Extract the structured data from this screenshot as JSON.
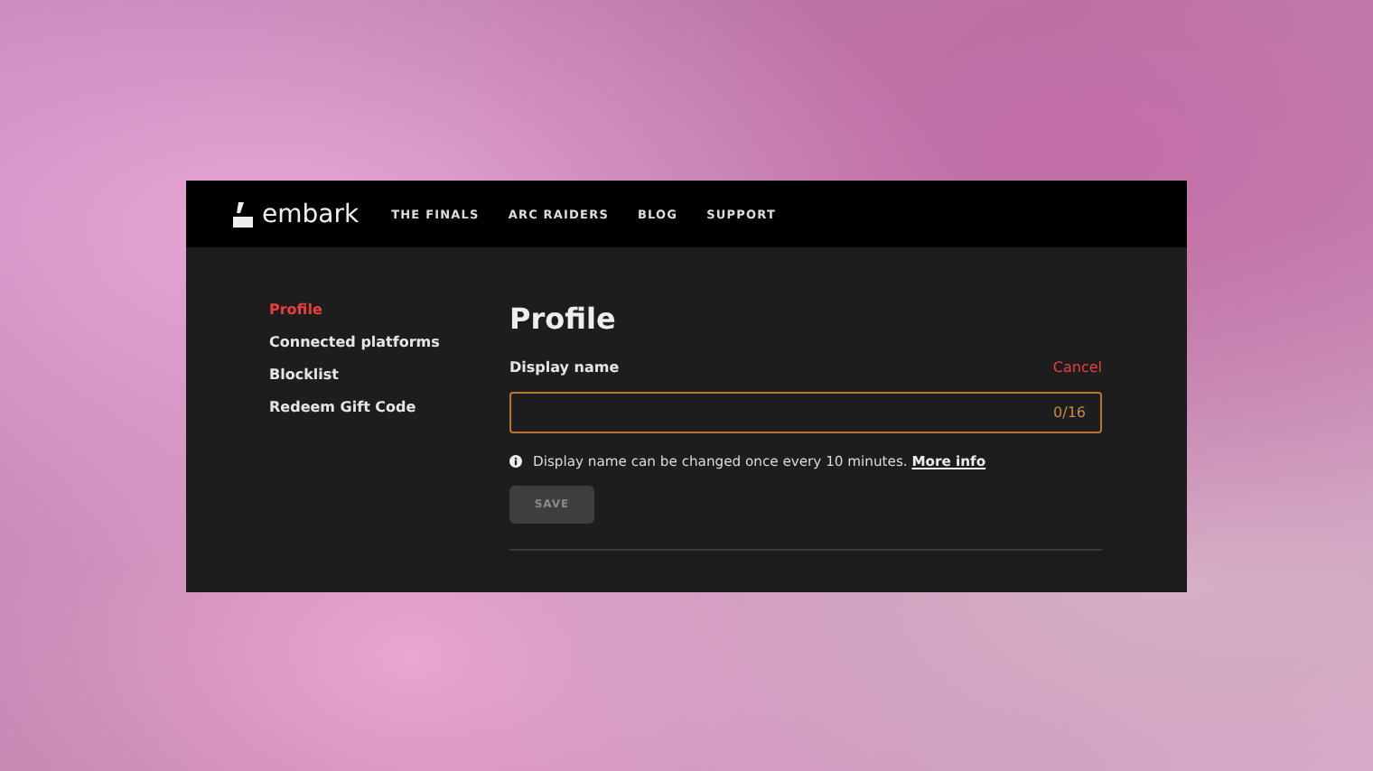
{
  "nav": {
    "logo_text": "embark",
    "links": [
      "THE FINALS",
      "ARC RAIDERS",
      "BLOG",
      "SUPPORT"
    ]
  },
  "sidebar": {
    "items": [
      {
        "label": "Profile",
        "selected": true
      },
      {
        "label": "Connected platforms",
        "selected": false
      },
      {
        "label": "Blocklist",
        "selected": false
      },
      {
        "label": "Redeem Gift Code",
        "selected": false
      }
    ]
  },
  "profile": {
    "title": "Profile",
    "field_label": "Display name",
    "cancel": "Cancel",
    "counter": "0/16",
    "info": "Display name can be changed once every 10 minutes.",
    "info_link": "More info",
    "save": {
      "label": "SAVE",
      "disabled": true
    }
  }
}
